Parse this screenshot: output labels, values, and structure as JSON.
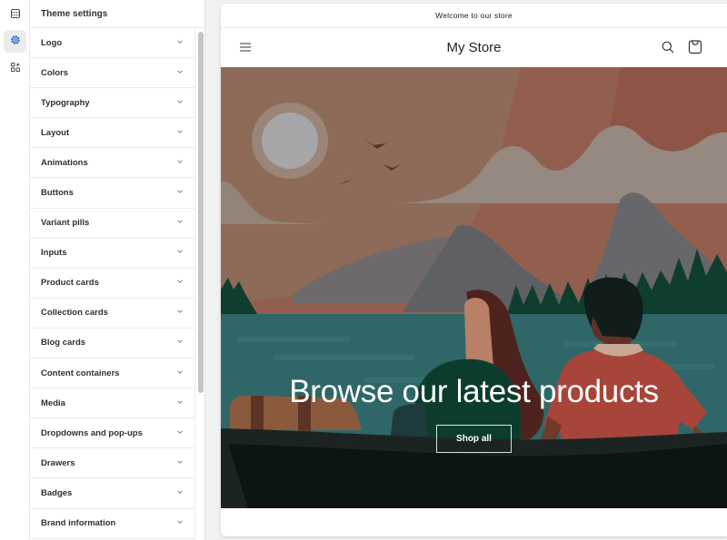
{
  "rail": {
    "items": [
      {
        "icon": "sections-icon",
        "active": false
      },
      {
        "icon": "gear-icon",
        "active": true
      },
      {
        "icon": "apps-icon",
        "active": false
      }
    ],
    "accent_color": "#2c6ecb"
  },
  "panel": {
    "title": "Theme settings",
    "items": [
      {
        "label": "Logo"
      },
      {
        "label": "Colors"
      },
      {
        "label": "Typography"
      },
      {
        "label": "Layout"
      },
      {
        "label": "Animations"
      },
      {
        "label": "Buttons"
      },
      {
        "label": "Variant pills"
      },
      {
        "label": "Inputs"
      },
      {
        "label": "Product cards"
      },
      {
        "label": "Collection cards"
      },
      {
        "label": "Blog cards"
      },
      {
        "label": "Content containers"
      },
      {
        "label": "Media"
      },
      {
        "label": "Dropdowns and pop-ups"
      },
      {
        "label": "Drawers"
      },
      {
        "label": "Badges"
      },
      {
        "label": "Brand information"
      }
    ]
  },
  "preview": {
    "announcement": "Welcome to our store",
    "store_name": "My Store",
    "hero": {
      "title": "Browse our latest products",
      "button_label": "Shop all"
    }
  }
}
